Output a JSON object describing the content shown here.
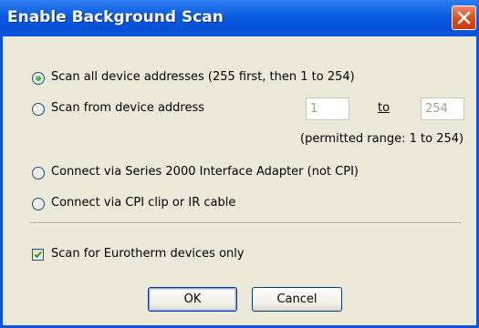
{
  "window": {
    "title": "Enable Background Scan"
  },
  "options": {
    "scan_all": {
      "label": "Scan all device addresses (255 first, then 1 to 254)",
      "selected": true
    },
    "scan_from": {
      "label": "Scan from device address",
      "selected": false,
      "from_value": "1",
      "to_label": "to",
      "to_value": "254",
      "range_note": "(permitted range: 1 to 254)"
    },
    "series2000": {
      "label": "Connect via Series 2000 Interface Adapter (not CPI)",
      "selected": false
    },
    "cpi": {
      "label": "Connect via CPI clip or IR cable",
      "selected": false
    }
  },
  "eurotherm_only": {
    "label": "Scan for Eurotherm devices only",
    "checked": true
  },
  "buttons": {
    "ok": "OK",
    "cancel": "Cancel"
  },
  "colors": {
    "titlebar": "#0a5ce0",
    "close": "#e04a18",
    "radio_dot": "#21a121",
    "checkmark": "#21a121"
  }
}
